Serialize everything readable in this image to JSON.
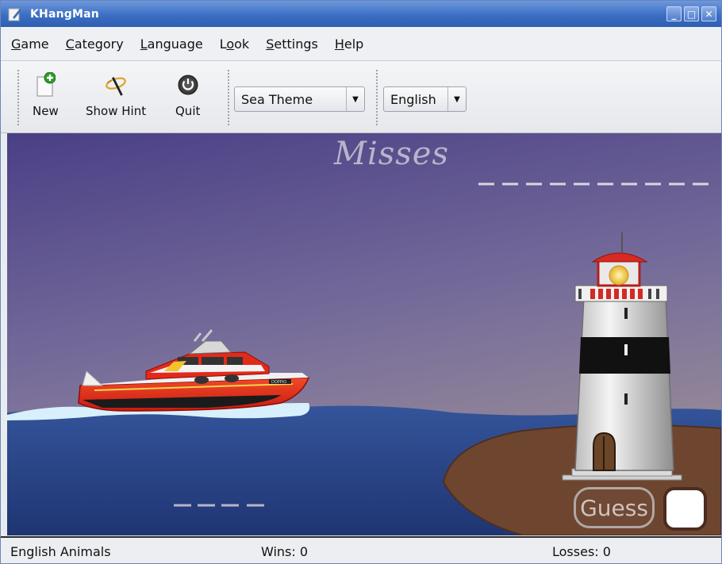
{
  "window": {
    "title": "KHangMan"
  },
  "menu": {
    "items": [
      {
        "label": "Game",
        "mnemonic": "G",
        "rest": "ame"
      },
      {
        "label": "Category",
        "mnemonic": "C",
        "rest": "ategory"
      },
      {
        "label": "Language",
        "mnemonic": "L",
        "rest": "anguage"
      },
      {
        "label": "Look",
        "pre": "L",
        "mnemonic": "o",
        "rest": "ok"
      },
      {
        "label": "Settings",
        "mnemonic": "S",
        "rest": "ettings"
      },
      {
        "label": "Help",
        "mnemonic": "H",
        "rest": "elp"
      }
    ]
  },
  "toolbar": {
    "new_label": "New",
    "hint_label": "Show Hint",
    "quit_label": "Quit",
    "theme_value": "Sea Theme",
    "language_value": "English"
  },
  "game": {
    "misses_label": "Misses",
    "misses_slots": 10,
    "word_slots": 4,
    "guess_label": "Guess",
    "guess_input_value": "",
    "boat_name": "DOPPIO",
    "theme_colors": {
      "sky_top": "#4a3f86",
      "sky_bottom": "#9a8d98",
      "sea": "#2c4a8e",
      "island": "#6e4630",
      "boat_hull": "#e32a1a"
    }
  },
  "status": {
    "language_category": "English  Animals",
    "wins": "Wins: 0",
    "losses": "Losses: 0"
  }
}
